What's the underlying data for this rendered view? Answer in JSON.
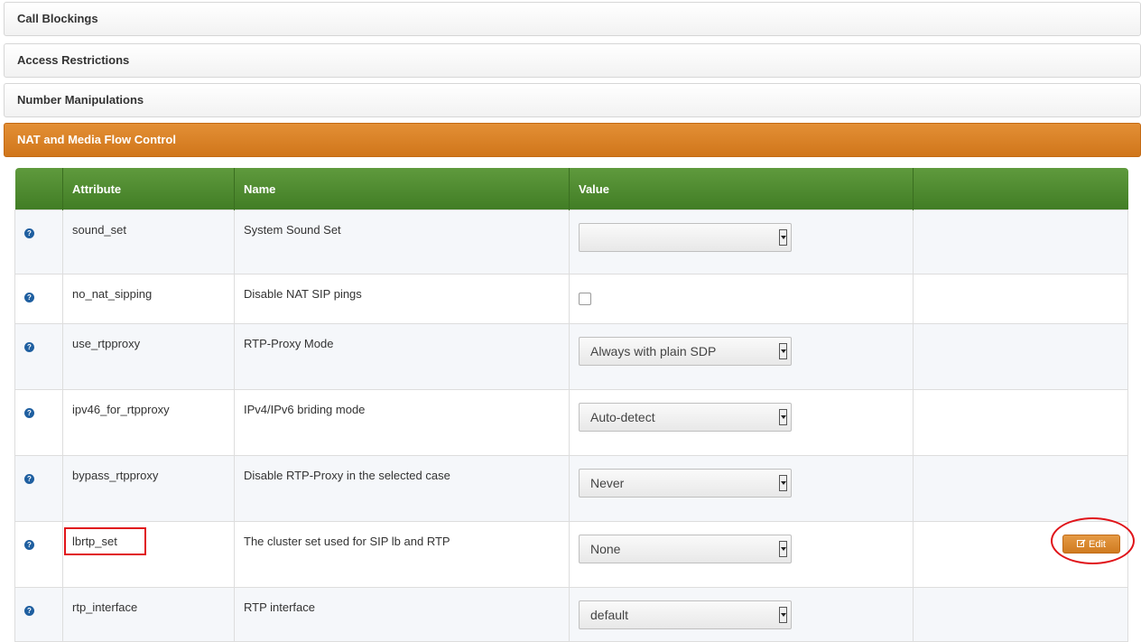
{
  "sections": [
    {
      "label": "Call Blockings"
    },
    {
      "label": "Access Restrictions"
    },
    {
      "label": "Number Manipulations"
    },
    {
      "label": "NAT and Media Flow Control"
    }
  ],
  "table": {
    "headers": [
      "",
      "Attribute",
      "Name",
      "Value",
      ""
    ],
    "rows": [
      {
        "attribute": "sound_set",
        "name": "System Sound Set",
        "value_type": "select",
        "value": ""
      },
      {
        "attribute": "no_nat_sipping",
        "name": "Disable NAT SIP pings",
        "value_type": "checkbox",
        "value": false
      },
      {
        "attribute": "use_rtpproxy",
        "name": "RTP-Proxy Mode",
        "value_type": "select",
        "value": "Always with plain SDP"
      },
      {
        "attribute": "ipv46_for_rtpproxy",
        "name": "IPv4/IPv6 briding mode",
        "value_type": "select",
        "value": "Auto-detect"
      },
      {
        "attribute": "bypass_rtpproxy",
        "name": "Disable RTP-Proxy in the selected case",
        "value_type": "select",
        "value": "Never"
      },
      {
        "attribute": "lbrtp_set",
        "name": "The cluster set used for SIP lb and RTP",
        "value_type": "select",
        "value": "None"
      },
      {
        "attribute": "rtp_interface",
        "name": "RTP interface",
        "value_type": "select",
        "value": "default"
      }
    ]
  },
  "edit_button": {
    "label": "Edit",
    "icon": "edit-icon"
  },
  "colors": {
    "accent": "#d9822b",
    "header_green": "#4a8a2c",
    "highlight": "#e0141a"
  }
}
